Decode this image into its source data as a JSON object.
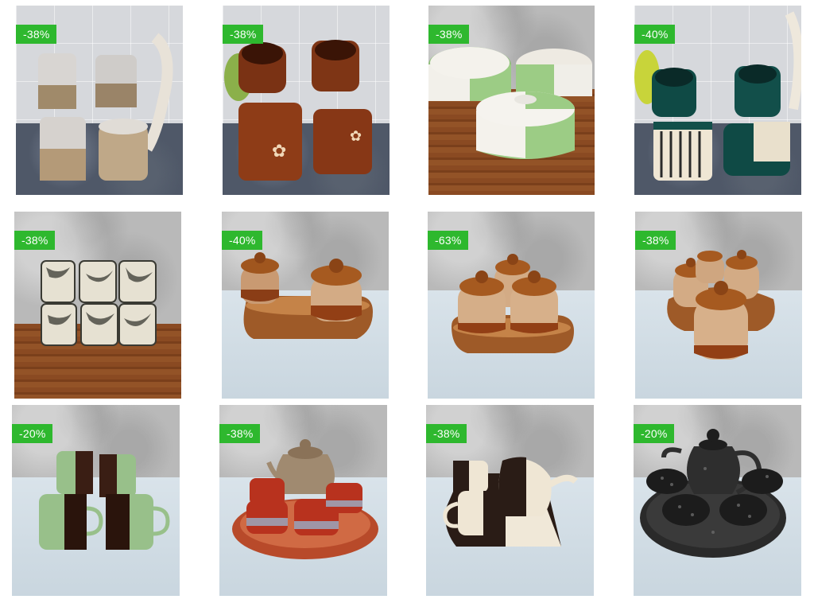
{
  "products": [
    {
      "badge": "-38%"
    },
    {
      "badge": "-38%"
    },
    {
      "badge": "-38%"
    },
    {
      "badge": "-40%"
    },
    {
      "badge": "-38%"
    },
    {
      "badge": "-40%"
    },
    {
      "badge": "-63%"
    },
    {
      "badge": "-38%"
    },
    {
      "badge": "-20%"
    },
    {
      "badge": "-38%"
    },
    {
      "badge": "-38%"
    },
    {
      "badge": "-20%"
    }
  ],
  "colors": {
    "badge_bg": "#2eb82e",
    "badge_text": "#ffffff"
  }
}
